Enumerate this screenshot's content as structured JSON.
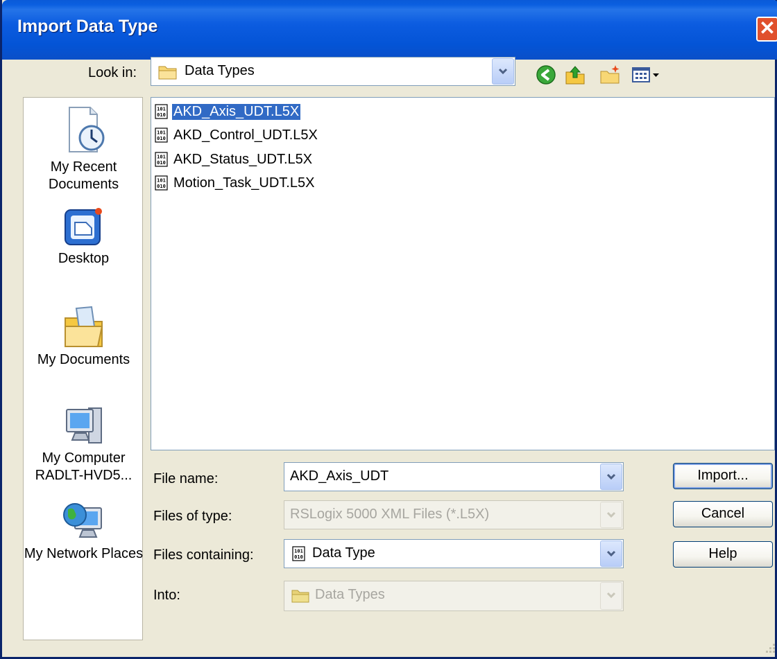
{
  "window": {
    "title": "Import Data Type",
    "close_glyph": "✕"
  },
  "toolbar": {
    "look_in_label": "Look in:",
    "look_in_value": "Data Types",
    "icons": [
      "back-icon",
      "up-one-level-icon",
      "new-folder-icon",
      "view-menu-icon"
    ]
  },
  "places": [
    {
      "label": "My Recent Documents",
      "icon": "recent-documents-icon"
    },
    {
      "label": "Desktop",
      "icon": "desktop-icon"
    },
    {
      "label": "My Documents",
      "icon": "my-documents-icon"
    },
    {
      "label": "My Computer RADLT-HVD5...",
      "icon": "my-computer-icon"
    },
    {
      "label": "My Network Places",
      "icon": "network-places-icon"
    }
  ],
  "files": [
    {
      "name": "AKD_Axis_UDT.L5X",
      "selected": true
    },
    {
      "name": "AKD_Control_UDT.L5X",
      "selected": false
    },
    {
      "name": "AKD_Status_UDT.L5X",
      "selected": false
    },
    {
      "name": "Motion_Task_UDT.L5X",
      "selected": false
    }
  ],
  "form": {
    "file_name_label": "File name:",
    "file_name_value": "AKD_Axis_UDT",
    "files_of_type_label": "Files of type:",
    "files_of_type_value": "RSLogix 5000 XML Files (*.L5X)",
    "files_containing_label": "Files containing:",
    "files_containing_value": "Data Type",
    "into_label": "Into:",
    "into_value": "Data Types"
  },
  "buttons": {
    "import": "Import...",
    "cancel": "Cancel",
    "help": "Help"
  },
  "colors": {
    "title_bar": "#0a5ad8",
    "selection": "#316ac5",
    "dialog_bg": "#ece9d8"
  }
}
